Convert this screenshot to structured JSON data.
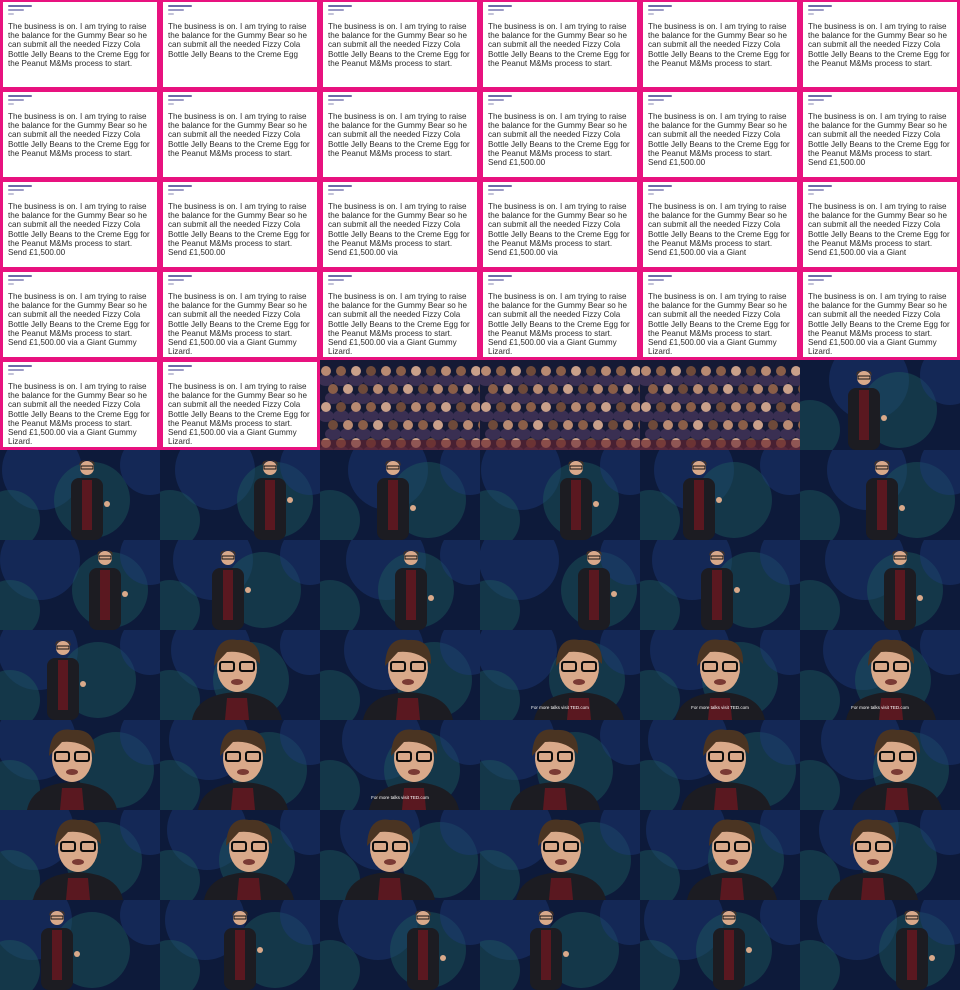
{
  "email": {
    "frames": [
      "The business is on. I am trying to raise the balance for the Gummy Bear so he can submit all the needed Fizzy Cola Bottle Jelly Beans to the Creme Egg for the Peanut M&Ms process to start.",
      "The business is on. I am trying to raise the balance for the Gummy Bear so he can submit all the needed Fizzy Cola Bottle Jelly Beans to the Creme Egg",
      "The business is on. I am trying to raise the balance for the Gummy Bear so he can submit all the needed Fizzy Cola Bottle Jelly Beans to the Creme Egg for the Peanut M&Ms process to start.",
      "The business is on. I am trying to raise the balance for the Gummy Bear so he can submit all the needed Fizzy Cola Bottle Jelly Beans to the Creme Egg for the Peanut M&Ms process to start.",
      "The business is on. I am trying to raise the balance for the Gummy Bear so he can submit all the needed Fizzy Cola Bottle Jelly Beans to the Creme Egg for the Peanut M&Ms process to start.",
      "The business is on. I am trying to raise the balance for the Gummy Bear so he can submit all the needed Fizzy Cola Bottle Jelly Beans to the Creme Egg for the Peanut M&Ms process to start.",
      "The business is on. I am trying to raise the balance for the Gummy Bear so he can submit all the needed Fizzy Cola Bottle Jelly Beans to the Creme Egg for the Peanut M&Ms process to start.",
      "The business is on. I am trying to raise the balance for the Gummy Bear so he can submit all the needed Fizzy Cola Bottle Jelly Beans to the Creme Egg for the Peanut M&Ms process to start.",
      "The business is on. I am trying to raise the balance for the Gummy Bear so he can submit all the needed Fizzy Cola Bottle Jelly Beans to the Creme Egg for the Peanut M&Ms process to start.",
      "The business is on. I am trying to raise the balance for the Gummy Bear so he can submit all the needed Fizzy Cola Bottle Jelly Beans to the Creme Egg for the Peanut M&Ms process to start. Send £1,500.00",
      "The business is on. I am trying to raise the balance for the Gummy Bear so he can submit all the needed Fizzy Cola Bottle Jelly Beans to the Creme Egg for the Peanut M&Ms process to start. Send £1,500.00",
      "The business is on. I am trying to raise the balance for the Gummy Bear so he can submit all the needed Fizzy Cola Bottle Jelly Beans to the Creme Egg for the Peanut M&Ms process to start. Send £1,500.00",
      "The business is on. I am trying to raise the balance for the Gummy Bear so he can submit all the needed Fizzy Cola Bottle Jelly Beans to the Creme Egg for the Peanut M&Ms process to start. Send £1,500.00",
      "The business is on. I am trying to raise the balance for the Gummy Bear so he can submit all the needed Fizzy Cola Bottle Jelly Beans to the Creme Egg for the Peanut M&Ms process to start. Send £1,500.00",
      "The business is on. I am trying to raise the balance for the Gummy Bear so he can submit all the needed Fizzy Cola Bottle Jelly Beans to the Creme Egg for the Peanut M&Ms process to start. Send £1,500.00 via",
      "The business is on. I am trying to raise the balance for the Gummy Bear so he can submit all the needed Fizzy Cola Bottle Jelly Beans to the Creme Egg for the Peanut M&Ms process to start. Send £1,500.00 via",
      "The business is on. I am trying to raise the balance for the Gummy Bear so he can submit all the needed Fizzy Cola Bottle Jelly Beans to the Creme Egg for the Peanut M&Ms process to start. Send £1,500.00 via a Giant",
      "The business is on. I am trying to raise the balance for the Gummy Bear so he can submit all the needed Fizzy Cola Bottle Jelly Beans to the Creme Egg for the Peanut M&Ms process to start. Send £1,500.00 via a Giant",
      "The business is on. I am trying to raise the balance for the Gummy Bear so he can submit all the needed Fizzy Cola Bottle Jelly Beans to the Creme Egg for the Peanut M&Ms process to start. Send £1,500.00 via a Giant Gummy",
      "The business is on. I am trying to raise the balance for the Gummy Bear so he can submit all the needed Fizzy Cola Bottle Jelly Beans to the Creme Egg for the Peanut M&Ms process to start. Send £1,500.00 via a Giant Gummy Lizard.",
      "The business is on. I am trying to raise the balance for the Gummy Bear so he can submit all the needed Fizzy Cola Bottle Jelly Beans to the Creme Egg for the Peanut M&Ms process to start. Send £1,500.00 via a Giant Gummy Lizard.",
      "The business is on. I am trying to raise the balance for the Gummy Bear so he can submit all the needed Fizzy Cola Bottle Jelly Beans to the Creme Egg for the Peanut M&Ms process to start. Send £1,500.00 via a Giant Gummy Lizard.",
      "The business is on. I am trying to raise the balance for the Gummy Bear so he can submit all the needed Fizzy Cola Bottle Jelly Beans to the Creme Egg for the Peanut M&Ms process to start. Send £1,500.00 via a Giant Gummy Lizard.",
      "The business is on. I am trying to raise the balance for the Gummy Bear so he can submit all the needed Fizzy Cola Bottle Jelly Beans to the Creme Egg for the Peanut M&Ms process to start. Send £1,500.00 via a Giant Gummy Lizard.",
      "The business is on. I am trying to raise the balance for the Gummy Bear so he can submit all the needed Fizzy Cola Bottle Jelly Beans to the Creme Egg for the Peanut M&Ms process to start. Send £1,500.00 via a Giant Gummy Lizard.",
      "The business is on. I am trying to raise the balance for the Gummy Bear so he can submit all the needed Fizzy Cola Bottle Jelly Beans to the Creme Egg for the Peanut M&Ms process to start. Send £1,500.00 via a Giant Gummy Lizard."
    ]
  },
  "video": {
    "subtitle": "For more talks visit TED.com",
    "frames": [
      {
        "kind": "audience"
      },
      {
        "kind": "audience"
      },
      {
        "kind": "audience"
      },
      {
        "kind": "full"
      },
      {
        "kind": "full"
      },
      {
        "kind": "full"
      },
      {
        "kind": "full"
      },
      {
        "kind": "full"
      },
      {
        "kind": "full"
      },
      {
        "kind": "full"
      },
      {
        "kind": "full"
      },
      {
        "kind": "full"
      },
      {
        "kind": "full"
      },
      {
        "kind": "full"
      },
      {
        "kind": "full"
      },
      {
        "kind": "full"
      },
      {
        "kind": "full"
      },
      {
        "kind": "close"
      },
      {
        "kind": "close"
      },
      {
        "kind": "close",
        "subtitle": true
      },
      {
        "kind": "close",
        "subtitle": true
      },
      {
        "kind": "close",
        "subtitle": true
      },
      {
        "kind": "close"
      },
      {
        "kind": "close"
      },
      {
        "kind": "close",
        "subtitle": true
      },
      {
        "kind": "close"
      },
      {
        "kind": "close"
      },
      {
        "kind": "close"
      },
      {
        "kind": "close"
      },
      {
        "kind": "close"
      },
      {
        "kind": "close"
      },
      {
        "kind": "close"
      },
      {
        "kind": "close"
      },
      {
        "kind": "close"
      },
      {
        "kind": "full"
      },
      {
        "kind": "full"
      },
      {
        "kind": "full"
      },
      {
        "kind": "full"
      },
      {
        "kind": "full"
      },
      {
        "kind": "full"
      }
    ]
  },
  "colors": {
    "frame_border": "#e8127f",
    "card": "#ffffff",
    "stage_dark": "#0d1a3a",
    "stage_blue": "#1c3a7a",
    "stage_teal": "#1d5a5e",
    "jacket": "#1c1c22",
    "shirt": "#5a1820",
    "skin": "#d9a98a",
    "hair": "#4a3422"
  }
}
